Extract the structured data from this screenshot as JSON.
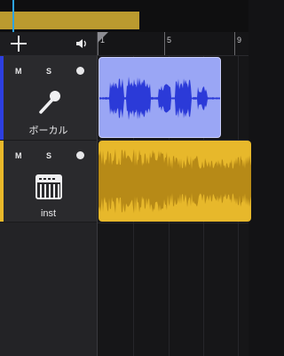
{
  "overview": {
    "region_color": "#bb9a2f",
    "playhead_color": "#2ea3e6"
  },
  "toolbar": {
    "add_icon": "plus-icon",
    "speaker_icon": "speaker-icon"
  },
  "ruler": {
    "markers": [
      "1",
      "5",
      "9"
    ]
  },
  "tracks": [
    {
      "name": "ボーカル",
      "mute_label": "M",
      "solo_label": "S",
      "icon": "microphone-icon",
      "color": "#2d3fe0",
      "region_color": "#9aa6f5",
      "waveform_color": "#2b3ad8"
    },
    {
      "name": "inst",
      "mute_label": "M",
      "solo_label": "S",
      "icon": "keyboard-icon",
      "color": "#e8b82a",
      "region_color": "#e7b82b",
      "waveform_color": "#b78a17"
    }
  ]
}
